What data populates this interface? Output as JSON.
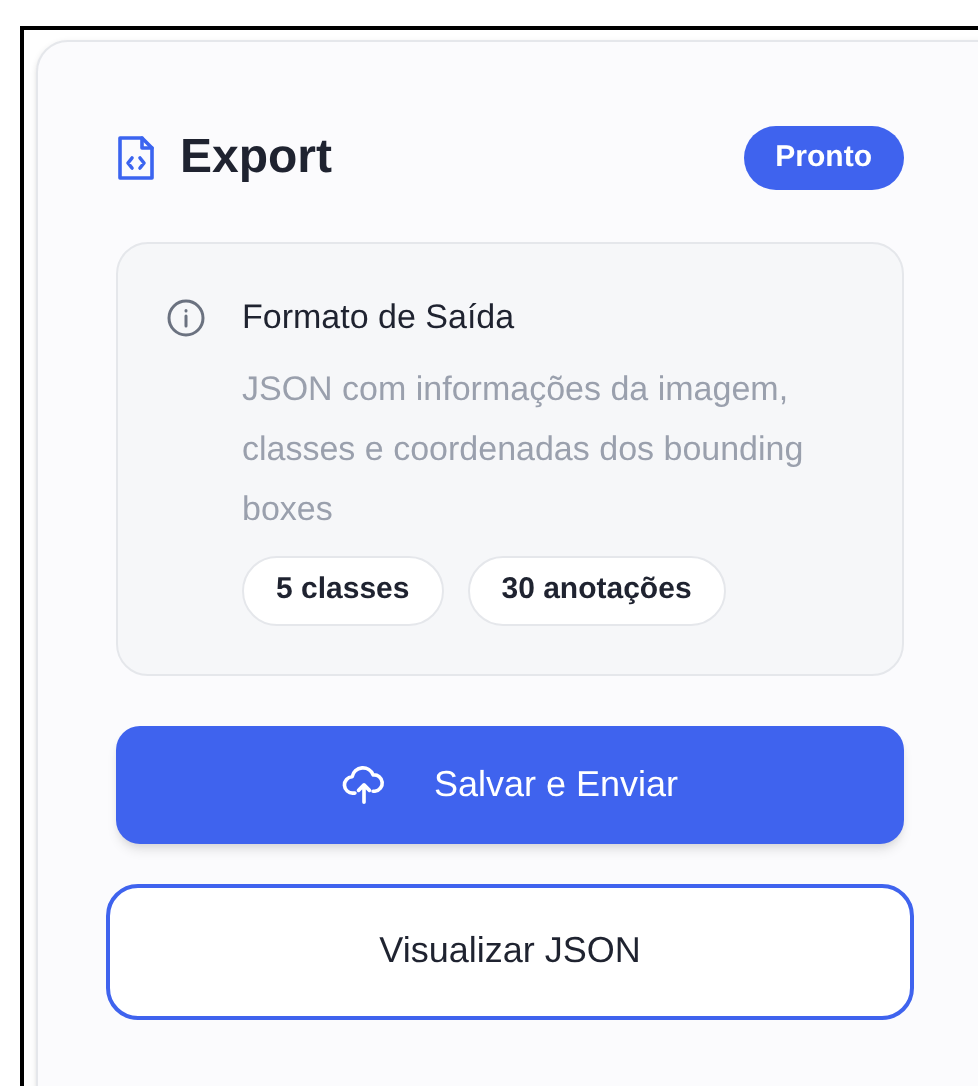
{
  "header": {
    "title": "Export",
    "badge": "Pronto"
  },
  "info": {
    "title": "Formato de Saída",
    "description": "JSON com informações da imagem, classes e coordenadas dos bounding boxes",
    "tags": [
      "5 classes",
      "30 anotações"
    ]
  },
  "buttons": [
    {
      "label": "Salvar e Enviar",
      "kind": "primary"
    },
    {
      "label": "Visualizar JSON",
      "kind": "outline"
    }
  ]
}
